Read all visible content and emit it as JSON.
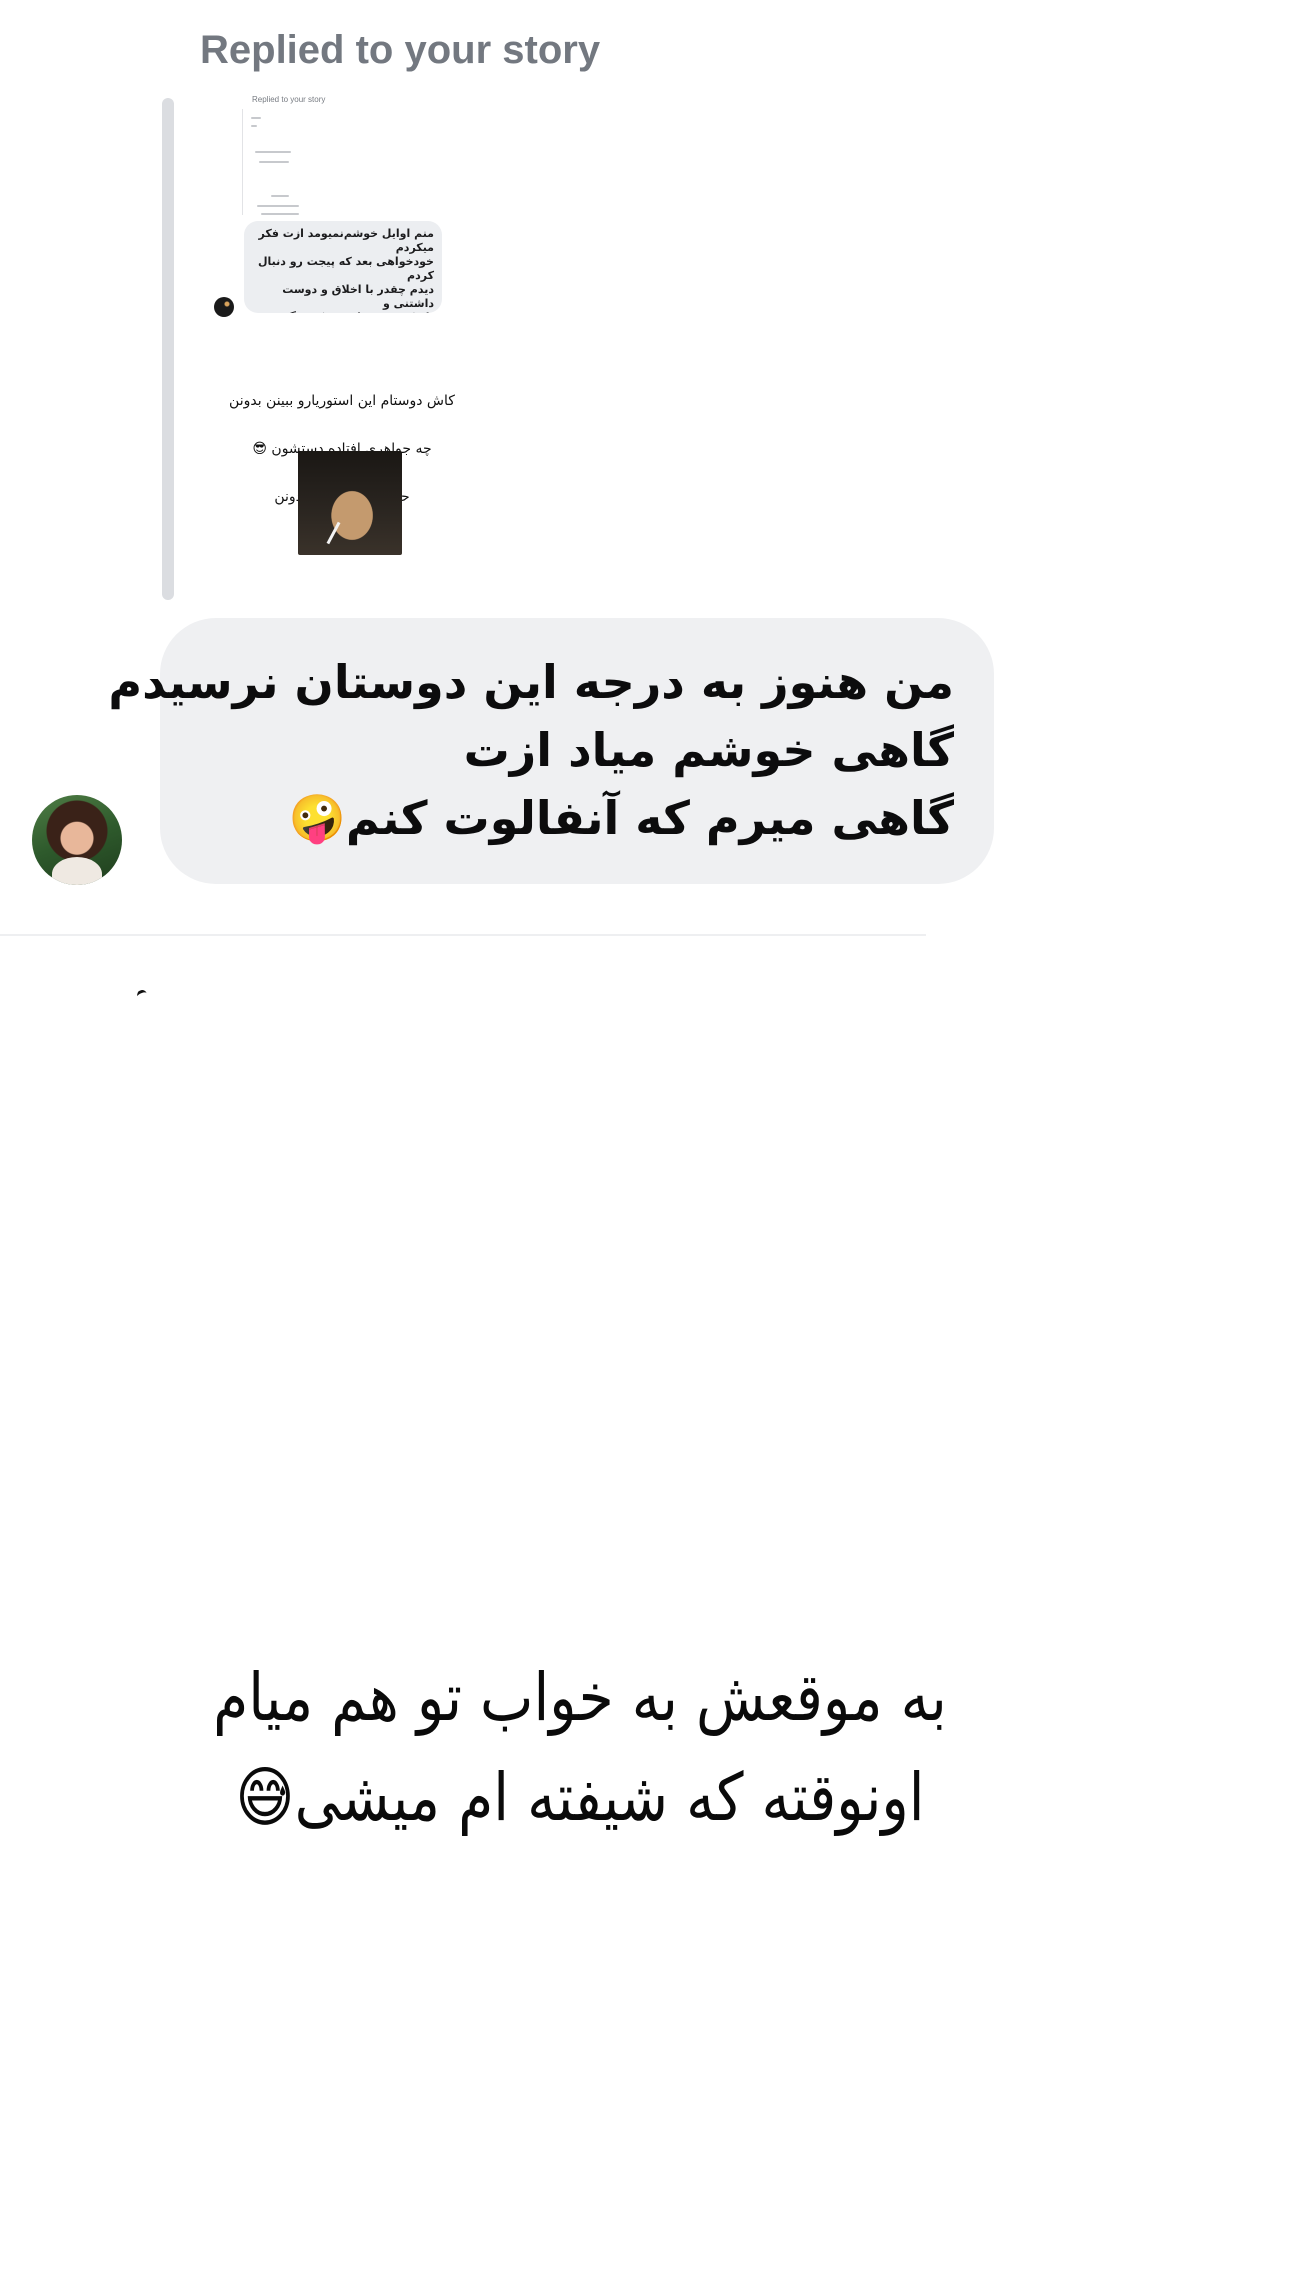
{
  "reply_header": {
    "label": "Replied to your story"
  },
  "story_preview": {
    "header_text": "Replied to your story",
    "inner_message": "منم اوایل خوشم‌نمیومد ازت فکر میکردم\nخودخواهی بعد که پیجت  رو دنبال کردم\nدیدم چقدر با اخلاق و دوست داشتنی  و\nبانمک هستی اینقدر که میگفتم چی میشد\nمنم همچین دوست باحالی داشتم 😍🌸\n😂",
    "caption_lines": [
      "کاش دوستام این استوریارو ببینن بدونن",
      "چه جواهری افتاده دستشون 😎",
      "حیف که قدرمو نمیدونن"
    ]
  },
  "message": {
    "lines": [
      "من هنوز به درجه این دوستان نرسیدم",
      "گاهی خوشم میاد ازت",
      "گاهی میرم که آنفالوت کنم🤪"
    ]
  },
  "overlay_caption": {
    "lines": [
      "به موقعش به خواب تو هم میام",
      "اونوقته که شیفته ام میشی😅"
    ]
  },
  "colors": {
    "bubble_bg": "#eff0f2",
    "header_text": "#737880",
    "text": "#0c0c0d"
  }
}
